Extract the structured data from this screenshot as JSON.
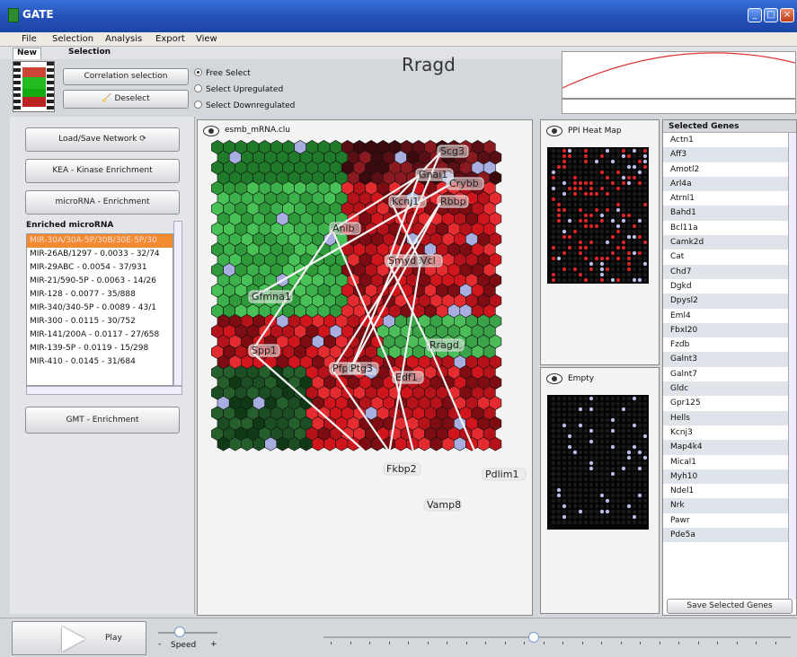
{
  "window": {
    "title": "GATE"
  },
  "menu": [
    "File",
    "Selection",
    "Analysis",
    "Export",
    "View"
  ],
  "tabs": {
    "new": "New",
    "selection": "Selection"
  },
  "selection": {
    "correlation_button": "Correlation selection",
    "deselect_button": "Deselect",
    "radio_options": [
      "Free Select",
      "Select Upregulated",
      "Select Downregulated"
    ],
    "selected_radio": "Free Select"
  },
  "gene_title": "Rragd",
  "left": {
    "buttons": [
      "Load/Save Network",
      "KEA - Kinase Enrichment",
      "microRNA - Enrichment",
      "GMT - Enrichment"
    ],
    "enriched_header": "Enriched microRNA",
    "mirna_items": [
      "MIR-30A/30A-5P/30B/30E-5P/30",
      "MIR-26AB/1297 - 0.0033 - 32/74",
      "MIR-29ABC - 0.0054 - 37/931",
      "MIR-21/590-5P - 0.0063 - 14/26",
      "MIR-128 - 0.0077 - 35/888",
      "MIR-340/340-5P - 0.0089 - 43/1",
      "MIR-300 - 0.0115 - 30/752",
      "MIR-141/200A - 0.0117 - 27/658",
      "MIR-139-5P - 0.0119 - 15/298",
      "MIR-410 - 0.0145 - 31/684"
    ]
  },
  "map": {
    "title": "esmb_mRNA.clu",
    "node_labels": [
      "Scg3",
      "Gnai1",
      "Crybb",
      "Rbbp",
      "Kcnj1",
      "Anlb",
      "Smyd3",
      "Vcl",
      "Gfmna1",
      "Rragd",
      "Spp1",
      "Pfpb",
      "Ptg3",
      "Edf1",
      "Fkbp2",
      "Pdlim1",
      "Vamp8"
    ]
  },
  "ppi": {
    "title": "PPI Heat Map"
  },
  "empty": {
    "title": "Empty"
  },
  "genes": {
    "header": "Selected Genes",
    "items": [
      "Actn1",
      "Aff3",
      "Amotl2",
      "Arl4a",
      "Atrnl1",
      "Bahd1",
      "Bcl11a",
      "Camk2d",
      "Cat",
      "Chd7",
      "Dgkd",
      "Dpysl2",
      "Eml4",
      "Fbxl20",
      "Fzdb",
      "Galnt3",
      "Galnt7",
      "Gldc",
      "Gpr125",
      "Hells",
      "Kcnj3",
      "Map4k4",
      "Mical1",
      "Myh10",
      "Ndel1",
      "Nrk",
      "Pawr",
      "Pde5a"
    ],
    "save_button": "Save Selected Genes"
  },
  "playback": {
    "play_label": "Play",
    "speed_label": "Speed"
  },
  "colors": {
    "titlebar": "#2350b8",
    "selected_item": "#f28a30",
    "up": "#d0161c",
    "down": "#25a83a",
    "mid": "#9aa0d6"
  }
}
